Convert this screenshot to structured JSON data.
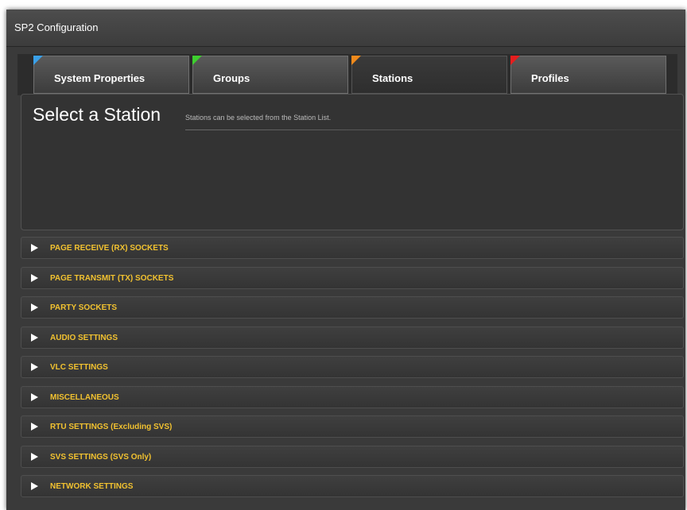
{
  "window": {
    "title": "SP2 Configuration"
  },
  "colors": {
    "accent_label": "#f2c230",
    "flag_blue": "#3aa0e8",
    "flag_green": "#3ecf2f",
    "flag_orange": "#f08a1c",
    "flag_red": "#e61e1e"
  },
  "tabs": [
    {
      "label": "System Properties",
      "flag_color": "#3aa0e8",
      "active": false
    },
    {
      "label": "Groups",
      "flag_color": "#3ecf2f",
      "active": false
    },
    {
      "label": "Stations",
      "flag_color": "#f08a1c",
      "active": true
    },
    {
      "label": "Profiles",
      "flag_color": "#e61e1e",
      "active": false
    }
  ],
  "panel": {
    "heading": "Select a Station",
    "hint": "Stations can be selected from the Station List."
  },
  "sections": [
    {
      "label": "PAGE RECEIVE (RX) SOCKETS",
      "icon": "expand-arrow-icon"
    },
    {
      "label": "PAGE TRANSMIT (TX) SOCKETS",
      "icon": "expand-arrow-icon"
    },
    {
      "label": "PARTY SOCKETS",
      "icon": "expand-arrow-icon"
    },
    {
      "label": "AUDIO SETTINGS",
      "icon": "expand-arrow-icon"
    },
    {
      "label": "VLC SETTINGS",
      "icon": "expand-arrow-icon"
    },
    {
      "label": "MISCELLANEOUS",
      "icon": "expand-arrow-icon"
    },
    {
      "label": "RTU SETTINGS (Excluding SVS)",
      "icon": "expand-arrow-icon"
    },
    {
      "label": "SVS SETTINGS (SVS Only)",
      "icon": "expand-arrow-icon"
    },
    {
      "label": "NETWORK SETTINGS",
      "icon": "expand-arrow-icon"
    }
  ]
}
